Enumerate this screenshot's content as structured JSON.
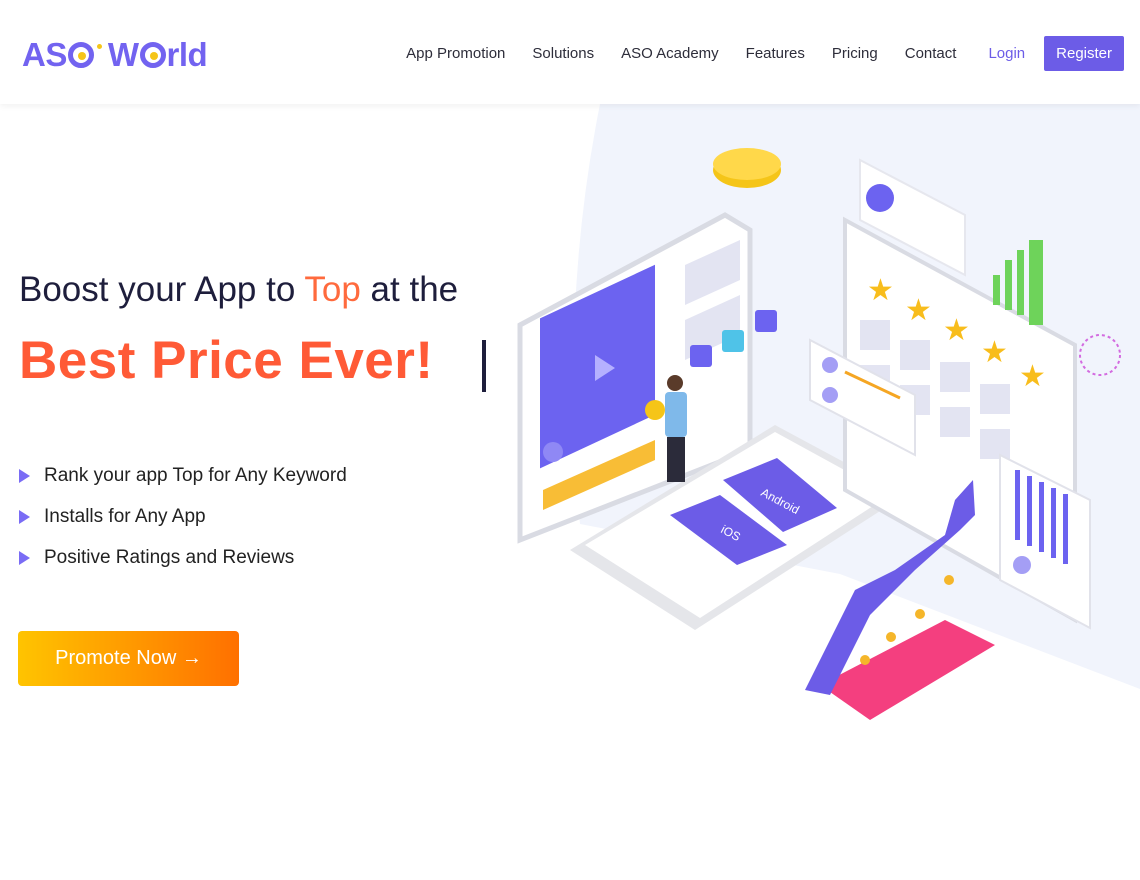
{
  "logo": {
    "text": "ASO World",
    "part1": "AS",
    "part2": "W",
    "part3": "rld"
  },
  "nav": {
    "items": [
      "App Promotion",
      "Solutions",
      "ASO Academy",
      "Features",
      "Pricing",
      "Contact"
    ],
    "login": "Login",
    "register": "Register"
  },
  "hero": {
    "line1_a": "Boost your App to ",
    "line1_top": "Top",
    "line1_b": " at the",
    "line2": "Best Price Ever!",
    "features": [
      "Rank your app Top for Any Keyword",
      "Installs for Any App",
      "Positive Ratings and Reviews"
    ],
    "cta": "Promote Now →"
  },
  "illustration": {
    "android_label": "Android",
    "ios_label": "iOS"
  },
  "colors": {
    "brand": "#6c5ce7",
    "accent": "#ff5a36",
    "cta_start": "#ffc400",
    "cta_end": "#ff7000"
  }
}
